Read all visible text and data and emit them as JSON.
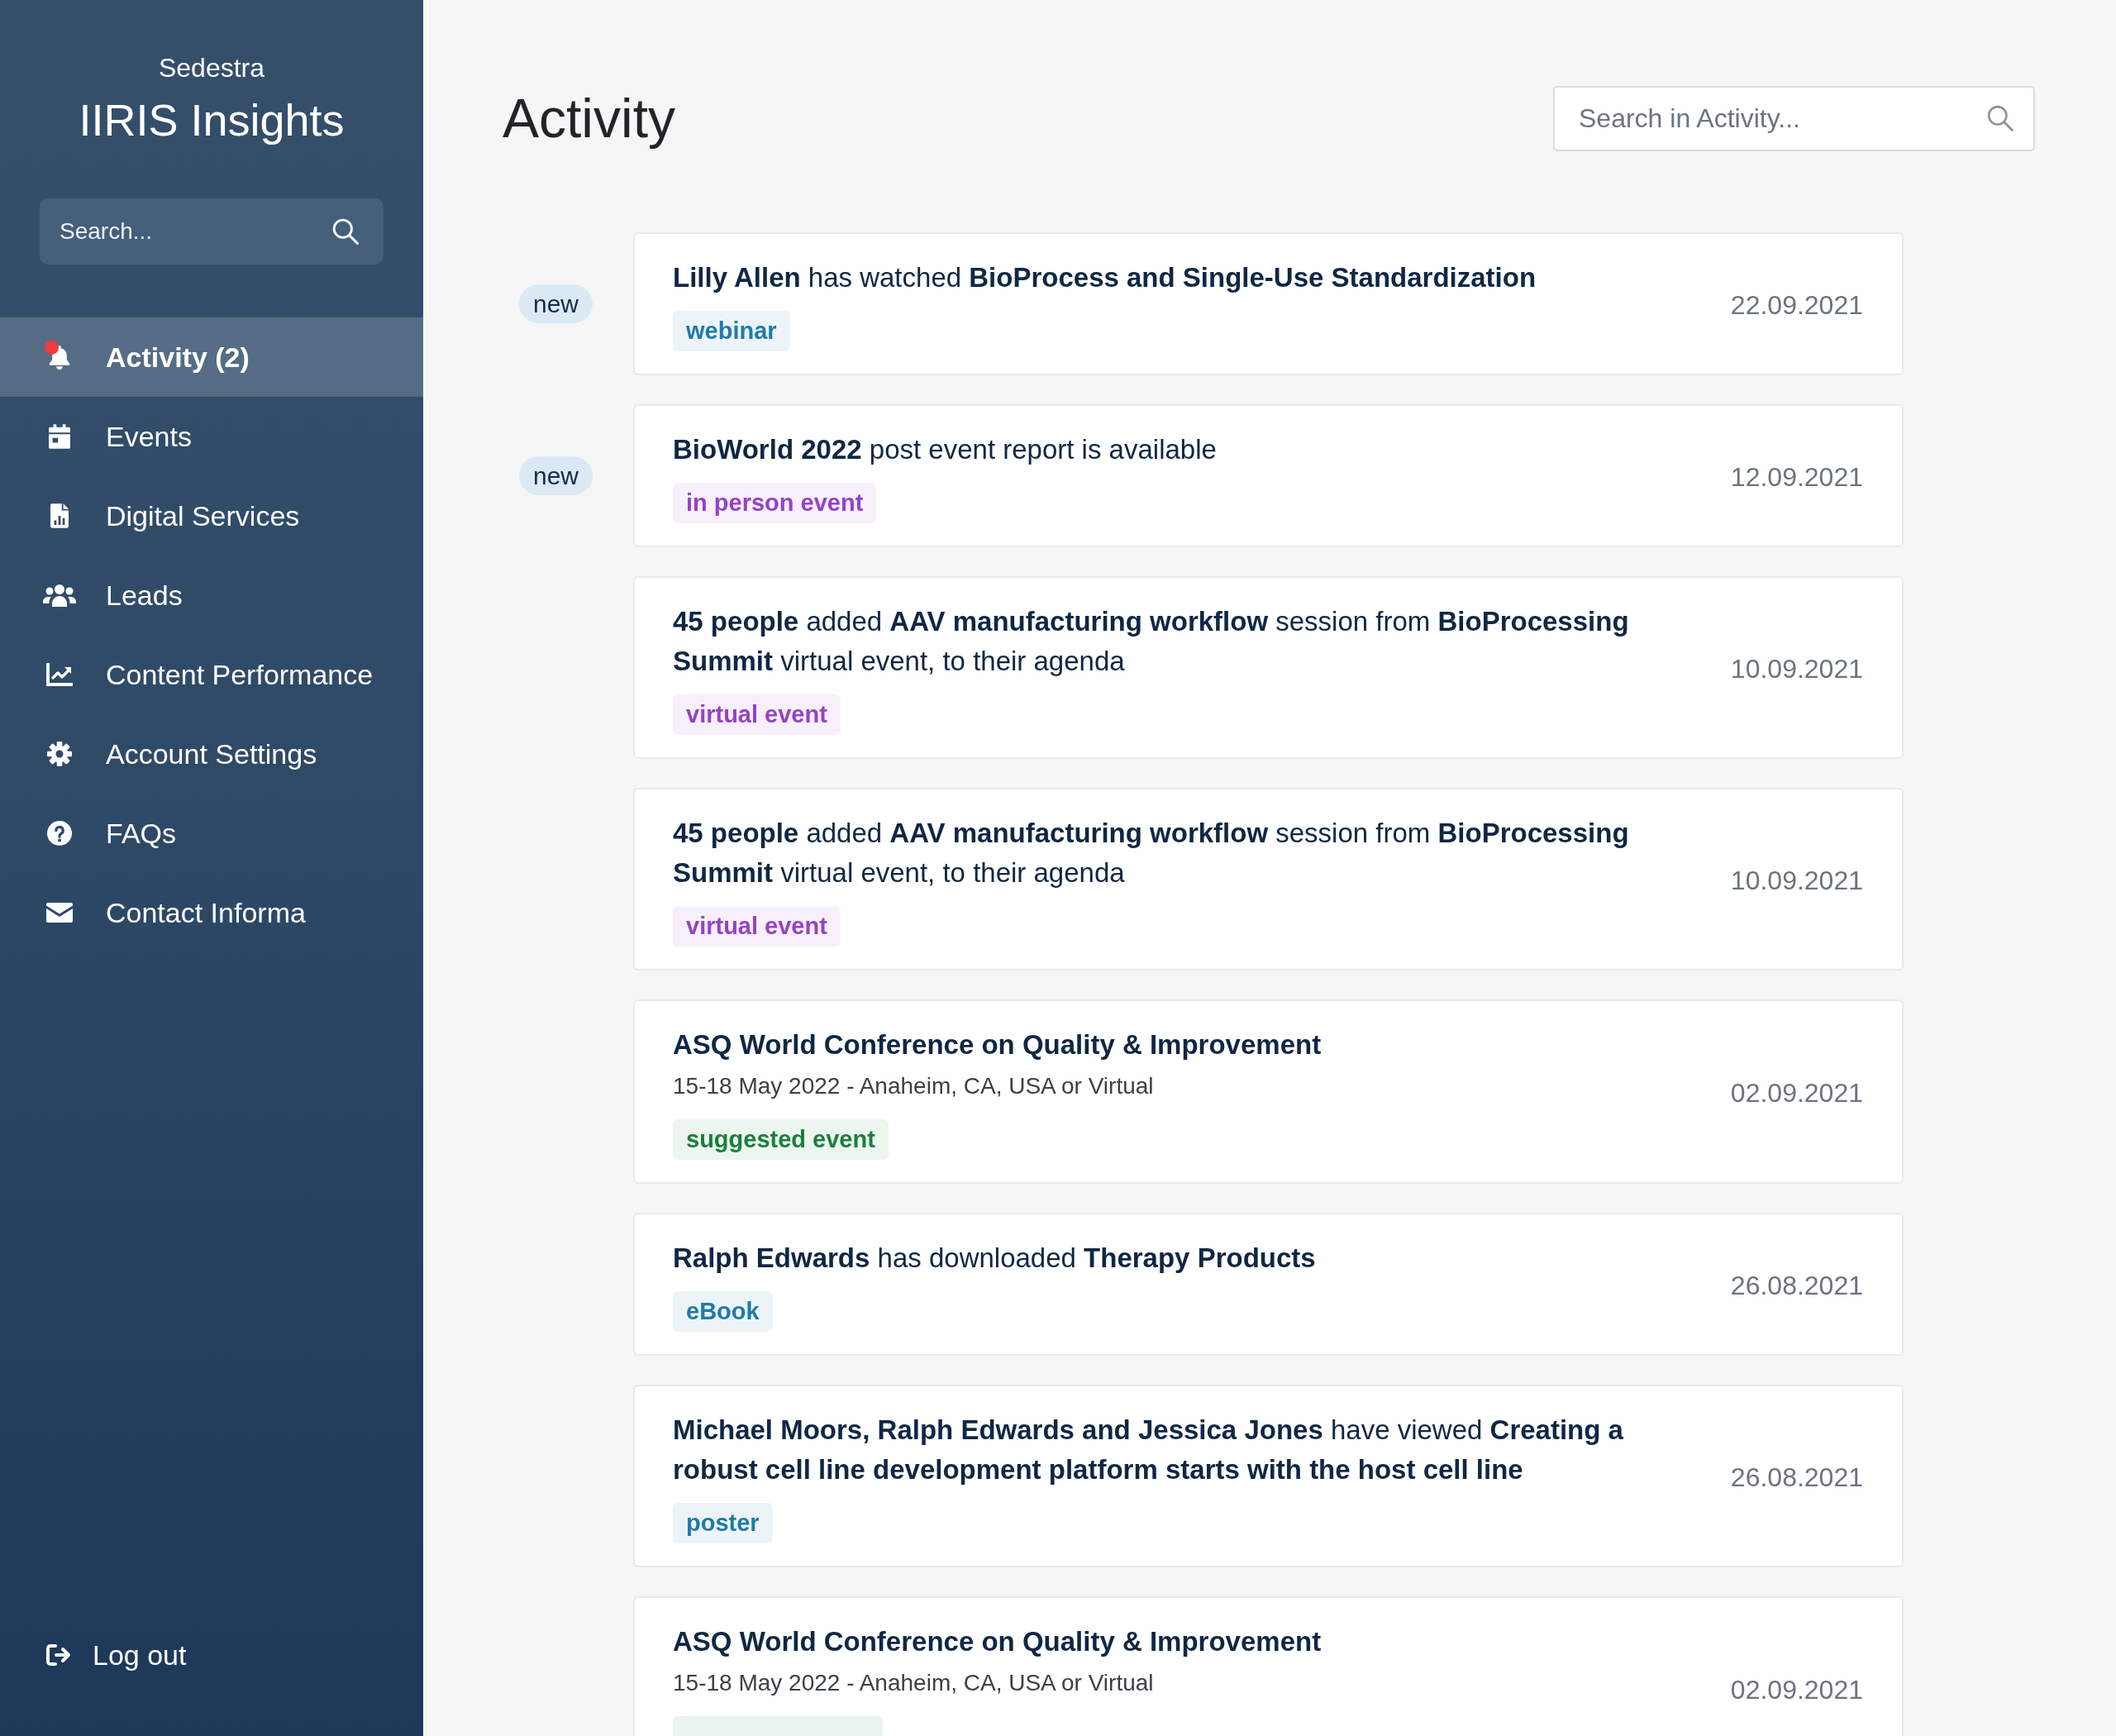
{
  "sidebar": {
    "brand_top": "Sedestra",
    "brand": "IIRIS Insights",
    "search": {
      "placeholder": "Search..."
    },
    "items": [
      {
        "label": "Activity (2)",
        "selected": true,
        "unread": true
      },
      {
        "label": "Events",
        "selected": false,
        "unread": false
      },
      {
        "label": "Digital Services",
        "selected": false,
        "unread": false
      },
      {
        "label": "Leads",
        "selected": false,
        "unread": false
      },
      {
        "label": "Content Performance",
        "selected": false,
        "unread": false
      },
      {
        "label": "Account Settings",
        "selected": false,
        "unread": false
      },
      {
        "label": "FAQs",
        "selected": false,
        "unread": false
      },
      {
        "label": "Contact Informa",
        "selected": false,
        "unread": false
      }
    ],
    "logout": "Log out"
  },
  "header": {
    "title": "Activity",
    "search": {
      "placeholder": "Search in Activity..."
    }
  },
  "activities": [
    {
      "kind": "activity",
      "badge": "new",
      "text": "**Lilly Allen** has watched **BioProcess and Single-Use Standardization**",
      "tag": {
        "label": "webinar",
        "color": "#1f7aa8"
      },
      "date": "22.09.2021"
    },
    {
      "kind": "activity",
      "badge": "new",
      "text": "**BioWorld 2022** post event report is available",
      "tag": {
        "label": "in person event",
        "color": "#9542c6"
      },
      "date": "12.09.2021"
    },
    {
      "kind": "activity",
      "text": "**45 people** added **AAV manufacturing workflow** session from **BioProcessing Summit** virtual event, to their agenda",
      "tag": {
        "label": "virtual event",
        "color": "#9542c6"
      },
      "date": "10.09.2021"
    },
    {
      "kind": "activity",
      "text": "**45 people** added **AAV manufacturing workflow** session from **BioProcessing Summit** virtual event, to their agenda",
      "tag": {
        "label": "virtual event",
        "color": "#9542c6"
      },
      "date": "10.09.2021"
    },
    {
      "kind": "event",
      "title": "ASQ World Conference on Quality & Improvement",
      "details": "15-18 May 2022 - Anaheim, CA, USA or Virtual",
      "tag": {
        "label": "suggested event",
        "color": "#1a7f3c"
      },
      "date": "02.09.2021"
    },
    {
      "kind": "activity",
      "text": "**Ralph Edwards** has downloaded **Therapy Products**",
      "tag": {
        "label": "eBook",
        "color": "#1f7aa8"
      },
      "date": "26.08.2021"
    },
    {
      "kind": "activity",
      "text": "**Michael Moors, Ralph Edwards and Jessica Jones** have viewed **Creating a robust cell line development platform starts with the host cell line**",
      "tag": {
        "label": "poster",
        "color": "#1f7aa8"
      },
      "date": "26.08.2021"
    },
    {
      "kind": "event",
      "title": "ASQ World Conference on Quality & Improvement",
      "details": "15-18 May 2022 - Anaheim, CA, USA or Virtual",
      "tag": {
        "color": "#ebf5ef"
      },
      "date": "02.09.2021"
    }
  ]
}
